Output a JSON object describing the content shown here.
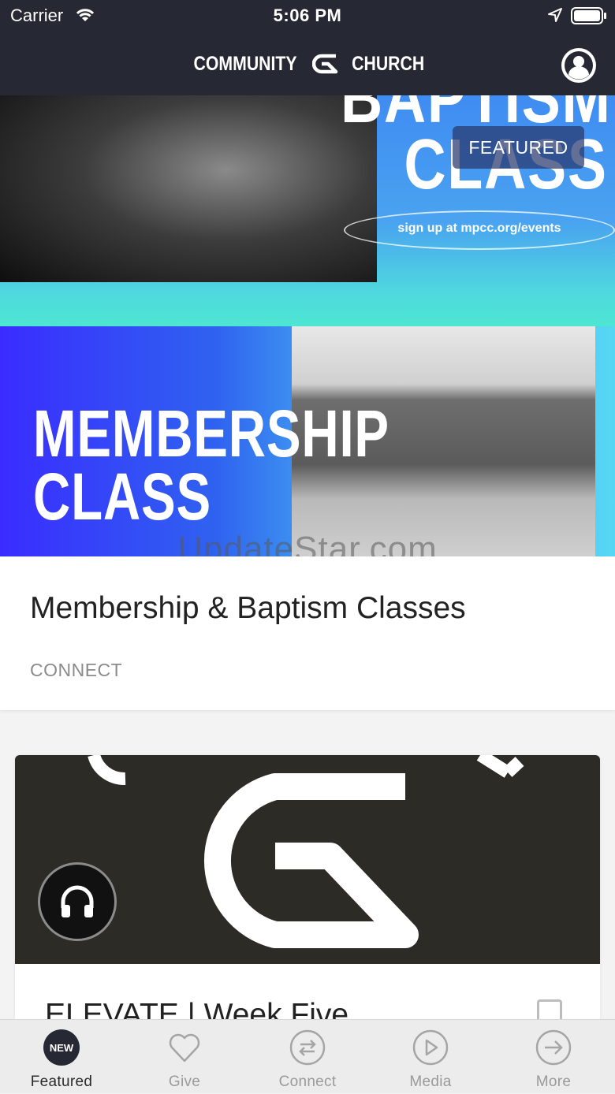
{
  "status_bar": {
    "carrier": "Carrier",
    "time": "5:06 PM"
  },
  "header": {
    "logo_left": "COMMUNITY",
    "logo_right": "CHURCH"
  },
  "hero": {
    "badge": "FEATURED",
    "baptism_line1": "BAPTISM",
    "baptism_line2": "CLASS",
    "signup": "sign up at mpcc.org/events",
    "membership_line1": "MEMBERSHIP",
    "membership_line2": "CLASS"
  },
  "watermark": "UpdateStar.com",
  "cards": [
    {
      "title": "Membership & Baptism Classes",
      "category": "CONNECT"
    },
    {
      "title": "ELEVATE | Week Five"
    }
  ],
  "tabs": [
    {
      "label": "Featured",
      "badge": "NEW",
      "icon": "new-badge-icon"
    },
    {
      "label": "Give",
      "icon": "heart-icon"
    },
    {
      "label": "Connect",
      "icon": "arrows-exchange-icon"
    },
    {
      "label": "Media",
      "icon": "play-icon"
    },
    {
      "label": "More",
      "icon": "arrow-right-icon"
    }
  ],
  "colors": {
    "nav_bg": "#262833",
    "accent_blue": "#3f8cf2",
    "tab_active": "#2a2a2a",
    "tab_inactive": "#9a9a9a"
  }
}
